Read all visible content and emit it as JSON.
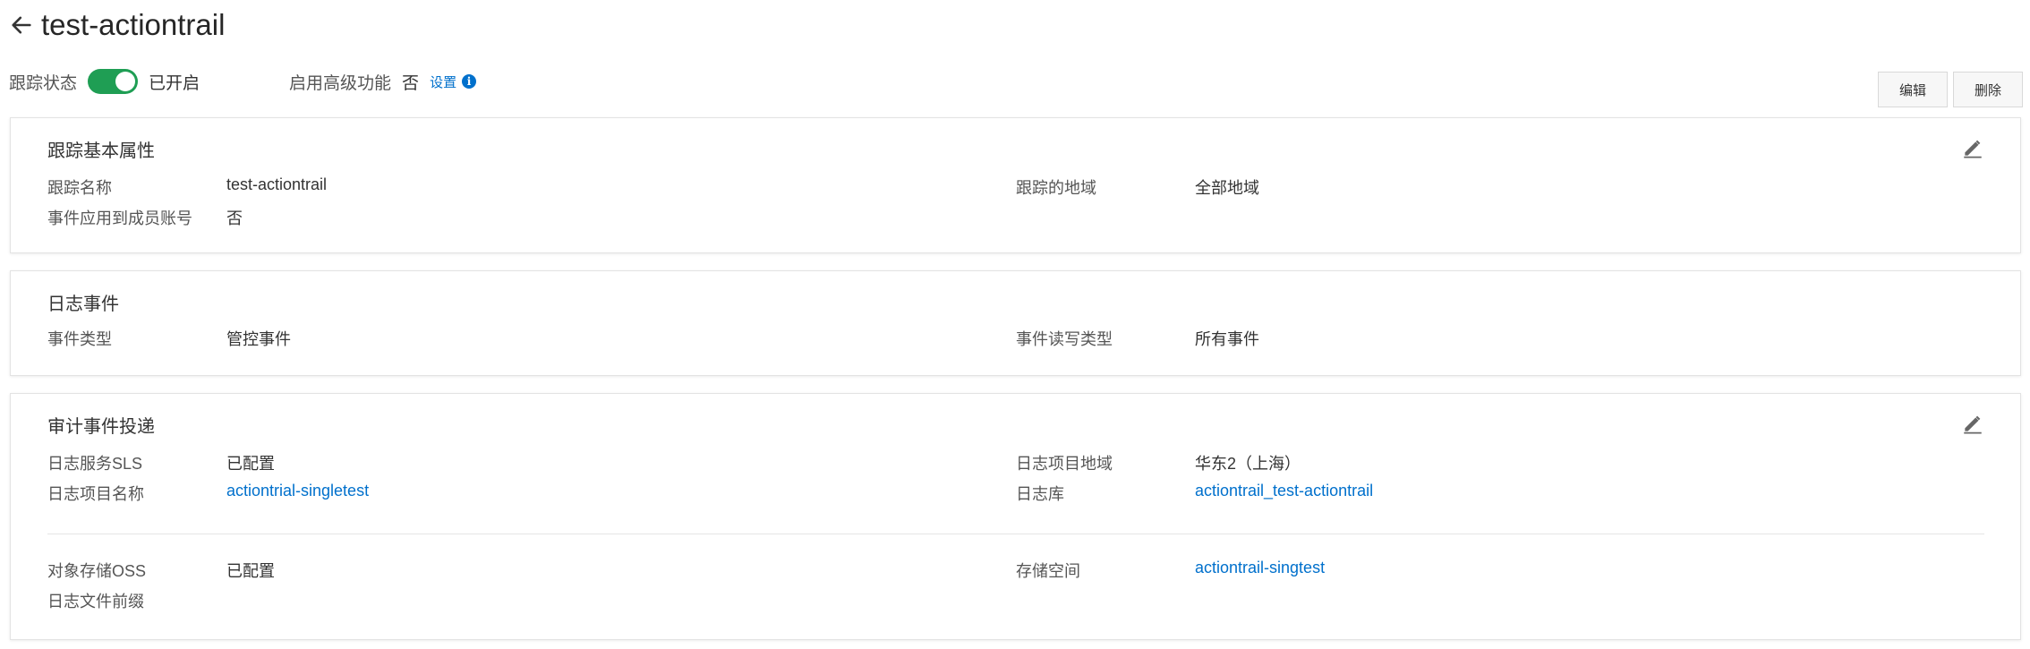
{
  "header": {
    "title": "test-actiontrail",
    "back_icon": "arrow-left-icon"
  },
  "status": {
    "tracking_label": "跟踪状态",
    "tracking_enabled": true,
    "tracking_text": "已开启",
    "advanced_label": "启用高级功能",
    "advanced_value": "否",
    "settings_link": "设置",
    "info_icon": "i"
  },
  "actions": {
    "edit_label": "编辑",
    "delete_label": "删除"
  },
  "basic": {
    "title": "跟踪基本属性",
    "name_label": "跟踪名称",
    "name_value": "test-actiontrail",
    "region_label": "跟踪的地域",
    "region_value": "全部地域",
    "member_label": "事件应用到成员账号",
    "member_value": "否"
  },
  "events": {
    "title": "日志事件",
    "type_label": "事件类型",
    "type_value": "管控事件",
    "rw_label": "事件读写类型",
    "rw_value": "所有事件"
  },
  "delivery": {
    "title": "审计事件投递",
    "sls_label": "日志服务SLS",
    "sls_value": "已配置",
    "project_region_label": "日志项目地域",
    "project_region_value": "华东2（上海）",
    "project_name_label": "日志项目名称",
    "project_name_value": "actiontrial-singletest",
    "logstore_label": "日志库",
    "logstore_value": "actiontrail_test-actiontrail",
    "oss_label": "对象存储OSS",
    "oss_value": "已配置",
    "bucket_label": "存储空间",
    "bucket_value": "actiontrail-singtest",
    "prefix_label": "日志文件前缀"
  },
  "colors": {
    "accent": "#0070cc",
    "toggle_on": "#1f9e54"
  }
}
